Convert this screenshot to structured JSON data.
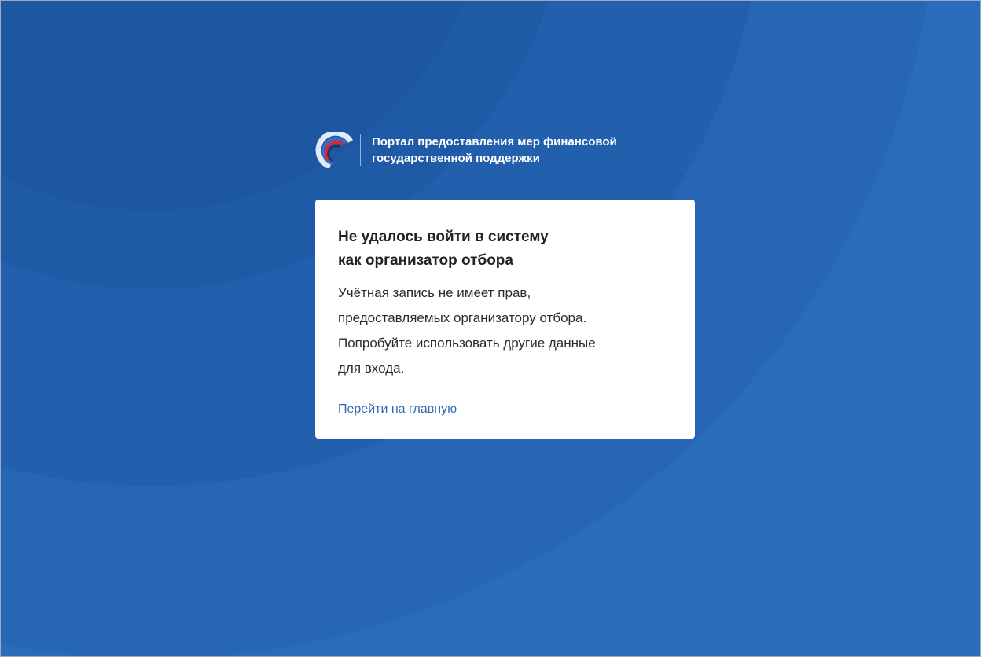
{
  "page": {
    "background_color": "#2b6bbb"
  },
  "header": {
    "logo_icon": "portal-logo-icon",
    "title": "Портал предоставления мер финансовой\nгосударственной поддержки"
  },
  "dialog": {
    "title": "Не удалось войти в систему\nкак организатор отбора",
    "message": "Учётная запись не имеет прав,\nпредоставляемых организатору отбора.\nПопробуйте использовать другие данные\nдля входа.",
    "link_label": "Перейти на главную",
    "link_color": "#2f68b5"
  },
  "colors": {
    "logo_light": "#dfeaf6",
    "logo_blue": "#2f6fc4",
    "logo_red": "#d8283a",
    "logo_navy": "#23325f"
  }
}
